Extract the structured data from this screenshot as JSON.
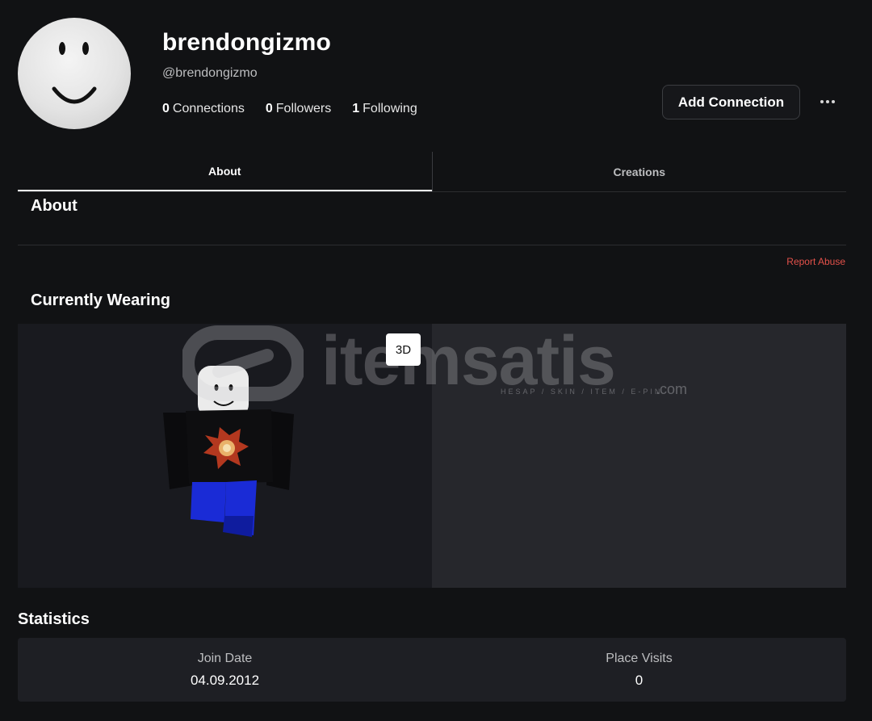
{
  "profile": {
    "display_name": "brendongizmo",
    "username": "@brendongizmo",
    "connections_count": "0",
    "connections_label": "Connections",
    "followers_count": "0",
    "followers_label": "Followers",
    "following_count": "1",
    "following_label": "Following"
  },
  "actions": {
    "add_connection_label": "Add Connection",
    "more_icon": "ellipsis-icon"
  },
  "tabs": [
    {
      "label": "About",
      "active": true
    },
    {
      "label": "Creations",
      "active": false
    }
  ],
  "about": {
    "title": "About",
    "report_abuse": "Report Abuse"
  },
  "wearing": {
    "title": "Currently Wearing",
    "view_toggle": "3D"
  },
  "watermark": {
    "text": "itemsatis",
    "subtext": "HESAP / SKIN / ITEM / E-PIN",
    "suffix": ".com"
  },
  "statistics": {
    "title": "Statistics",
    "items": [
      {
        "label": "Join Date",
        "value": "04.09.2012"
      },
      {
        "label": "Place Visits",
        "value": "0"
      }
    ]
  },
  "colors": {
    "background": "#111214",
    "panel": "#1e1f24",
    "report_abuse": "#e4514a",
    "pants": "#1a2bd6",
    "shirt": "#0b0b0d"
  }
}
